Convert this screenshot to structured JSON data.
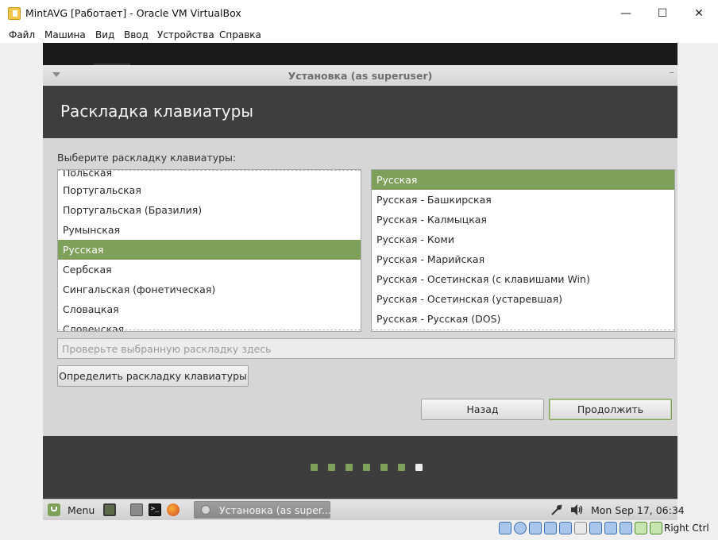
{
  "window": {
    "title": "MintAVG [Работает] - Oracle VM VirtualBox",
    "minimize": "—",
    "maximize": "☐",
    "close": "✕"
  },
  "menubar": [
    "Файл",
    "Машина",
    "Вид",
    "Ввод",
    "Устройства",
    "Справка"
  ],
  "installer": {
    "title": "Установка (as superuser)",
    "heading": "Раскладка клавиатуры",
    "prompt": "Выберите раскладку клавиатуры:",
    "layouts": [
      "Польская",
      "Португальская",
      "Португальская (Бразилия)",
      "Румынская",
      "Русская",
      "Сербская",
      "Сингальская (фонетическая)",
      "Словацкая",
      "Словенская"
    ],
    "layout_selected": "Русская",
    "variants": [
      "Русская",
      "Русская - Башкирская",
      "Русская - Калмыцкая",
      "Русская - Коми",
      "Русская - Марийская",
      "Русская - Осетинская (с клавишами Win)",
      "Русская - Осетинская (устаревшая)",
      "Русская - Русская (DOS)"
    ],
    "variant_selected": "Русская",
    "test_placeholder": "Проверьте выбранную раскладку здесь",
    "test_value": "",
    "detect_button": "Определить раскладку клавиатуры",
    "back_button": "Назад",
    "continue_button": "Продолжить",
    "progress": {
      "total_steps": 7,
      "current_step": 7
    }
  },
  "taskbar": {
    "menu_label": "Menu",
    "terminal_glyph": ">_",
    "task_label": "Установка (as super...",
    "clock": "Mon Sep 17, 06:34"
  },
  "statusbar": {
    "host_key": "Right Ctrl",
    "icons": [
      "hdd-icon",
      "optical-icon",
      "audio-icon",
      "network-icon",
      "usb-icon",
      "shared-folder-icon",
      "display-icon",
      "video-capture-icon",
      "cpu-icon",
      "mouse-integration-icon",
      "keyboard-icon"
    ]
  },
  "colors": {
    "accent": "#7ea05a",
    "header_bg": "#3e3e3e",
    "dialog_bg": "#d6d6d6"
  }
}
